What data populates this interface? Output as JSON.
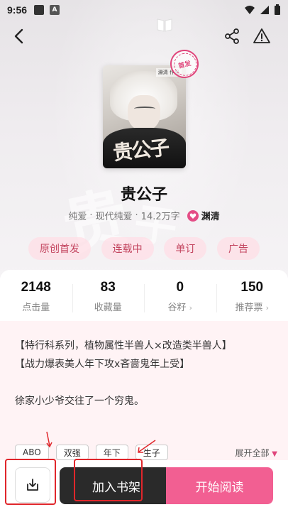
{
  "status_bar": {
    "time": "9:56",
    "a_icon": "A"
  },
  "book": {
    "title": "贵公子",
    "cover_brush": "贵公子",
    "cover_tag": "淵清 作品",
    "stamp": "首发",
    "genre": "纯爱",
    "sub_genre": "现代纯爱",
    "words": "14.2万字",
    "author": "渊清",
    "dot": "·"
  },
  "chips": [
    "原创首发",
    "连载中",
    "单订",
    "广告"
  ],
  "stats": [
    {
      "value": "2148",
      "label": "点击量",
      "chevron": ""
    },
    {
      "value": "83",
      "label": "收藏量",
      "chevron": ""
    },
    {
      "value": "0",
      "label": "谷籽",
      "chevron": "›"
    },
    {
      "value": "150",
      "label": "推荐票",
      "chevron": "›"
    }
  ],
  "description": {
    "line1": "【特行科系列，植物属性半兽人×改造类半兽人】",
    "line2": "【战力爆表美人年下攻x吝啬鬼年上受】",
    "line3": "徐家小少爷交往了一个穷鬼。"
  },
  "hashtags": [
    "ABO",
    "双强",
    "年下",
    "生子"
  ],
  "expand_label": "展开全部",
  "bottom": {
    "shelf_label": "加入书架",
    "read_label": "开始阅读"
  },
  "colors": {
    "accent": "#f25f92",
    "dark_button": "#2a2a2a",
    "annotation": "#e0262b"
  }
}
